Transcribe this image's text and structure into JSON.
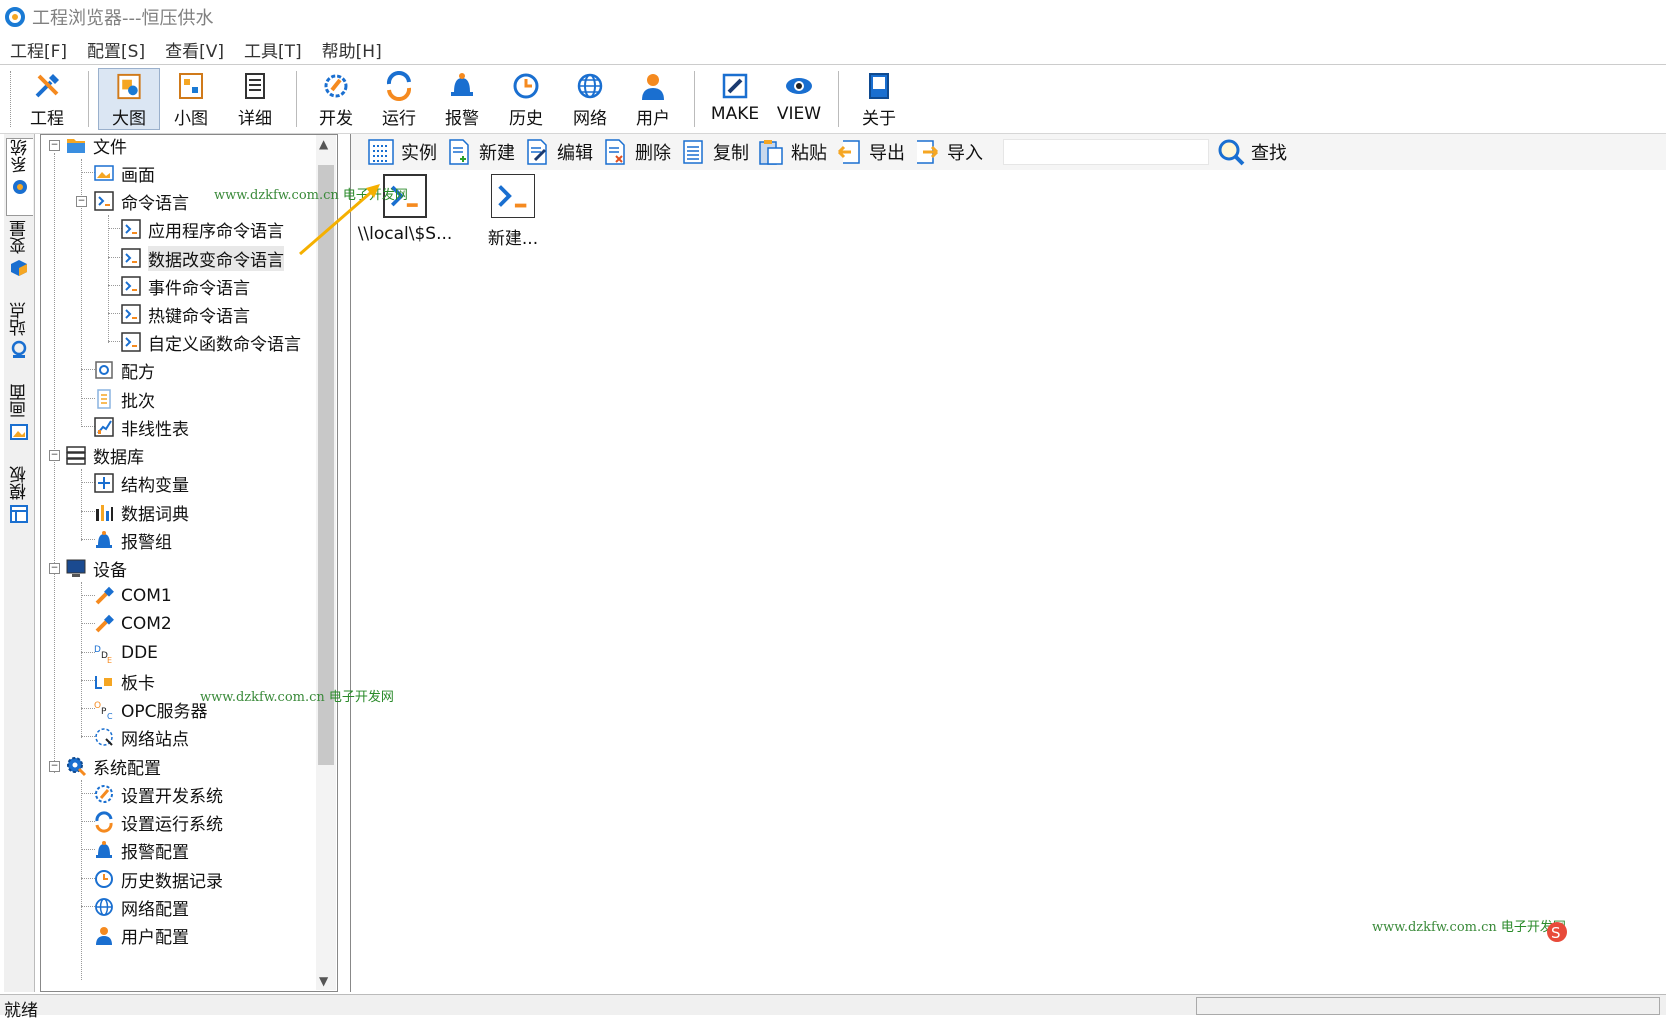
{
  "window": {
    "title": "工程浏览器---恒压供水"
  },
  "menu": [
    "工程[F]",
    "配置[S]",
    "查看[V]",
    "工具[T]",
    "帮助[H]"
  ],
  "toolbar": {
    "project": "工程",
    "large": "大图",
    "small": "小图",
    "detail": "详细",
    "develop": "开发",
    "run": "运行",
    "alarm": "报警",
    "history": "历史",
    "network": "网络",
    "user": "用户",
    "make": "MAKE",
    "view": "VIEW",
    "about": "关于"
  },
  "side_tabs": [
    "系统",
    "变量",
    "站点",
    "画面",
    "模板"
  ],
  "tree": {
    "file": "文件",
    "screen": "画面",
    "cmd": "命令语言",
    "cmd_app": "应用程序命令语言",
    "cmd_data": "数据改变命令语言",
    "cmd_event": "事件命令语言",
    "cmd_hotkey": "热键命令语言",
    "cmd_func": "自定义函数命令语言",
    "recipe": "配方",
    "batch": "批次",
    "nonlinear": "非线性表",
    "db": "数据库",
    "struct": "结构变量",
    "dict": "数据词典",
    "alarmgroup": "报警组",
    "device": "设备",
    "com1": "COM1",
    "com2": "COM2",
    "dde": "DDE",
    "board": "板卡",
    "opc": "OPC服务器",
    "netsite": "网络站点",
    "sysconf": "系统配置",
    "set_dev": "设置开发系统",
    "set_run": "设置运行系统",
    "alarm_conf": "报警配置",
    "hist_rec": "历史数据记录",
    "net_conf": "网络配置",
    "user_conf": "用户配置"
  },
  "content_toolbar": {
    "instance": "实例",
    "new": "新建",
    "edit": "编辑",
    "delete": "删除",
    "copy": "复制",
    "paste": "粘贴",
    "export": "导出",
    "import": "导入",
    "search_value": "",
    "find": "查找"
  },
  "items": [
    {
      "label": "\\\\local\\$S..."
    },
    {
      "label": "新建..."
    }
  ],
  "status": "就绪",
  "watermark": {
    "url": "www.dzkfw.com.cn",
    "site": "电子开发网"
  }
}
